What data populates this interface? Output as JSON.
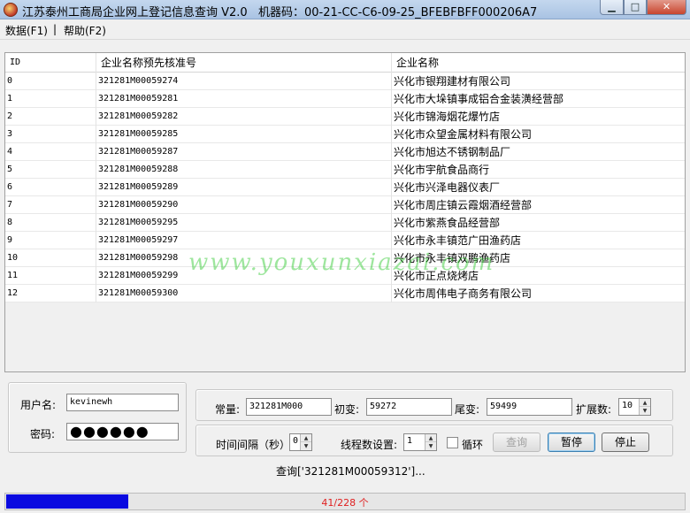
{
  "window": {
    "title": "江苏泰州工商局企业网上登记信息查询 V2.0",
    "machine_code": "机器码：00-21-CC-C6-09-25_BFEBFBFF000206A7",
    "min_glyph": "▁",
    "max_glyph": "□",
    "close_glyph": "✕"
  },
  "menu": {
    "data": "数据(F1)",
    "separator": "|",
    "help": "帮助(F2)"
  },
  "table": {
    "headers": {
      "id": "ID",
      "code": "企业名称预先核准号",
      "name": "企业名称"
    },
    "rows": [
      {
        "id": "0",
        "code": "321281M00059274",
        "name": "兴化市银翔建材有限公司"
      },
      {
        "id": "1",
        "code": "321281M00059281",
        "name": "兴化市大垛镇事成铝合金装潢经营部"
      },
      {
        "id": "2",
        "code": "321281M00059282",
        "name": "兴化市锦海烟花爆竹店"
      },
      {
        "id": "3",
        "code": "321281M00059285",
        "name": "兴化市众望金属材料有限公司"
      },
      {
        "id": "4",
        "code": "321281M00059287",
        "name": "兴化市旭达不锈钢制品厂"
      },
      {
        "id": "5",
        "code": "321281M00059288",
        "name": "兴化市宇航食品商行"
      },
      {
        "id": "6",
        "code": "321281M00059289",
        "name": "兴化市兴泽电器仪表厂"
      },
      {
        "id": "7",
        "code": "321281M00059290",
        "name": "兴化市周庄镇云霞烟酒经营部"
      },
      {
        "id": "8",
        "code": "321281M00059295",
        "name": "兴化市紫燕食品经营部"
      },
      {
        "id": "9",
        "code": "321281M00059297",
        "name": "兴化市永丰镇范广田渔药店"
      },
      {
        "id": "10",
        "code": "321281M00059298",
        "name": "兴化市永丰镇双鹏渔药店"
      },
      {
        "id": "11",
        "code": "321281M00059299",
        "name": "兴化市正点烧烤店"
      },
      {
        "id": "12",
        "code": "321281M00059300",
        "name": "兴化市周伟电子商务有限公司"
      }
    ]
  },
  "watermark": "www.youxunxiazai.com",
  "login": {
    "username_label": "用户名:",
    "username_value": "kevinewh",
    "password_label": "密码:",
    "password_value": "●●●●●●"
  },
  "params": {
    "constant_label": "常量:",
    "constant_value": "321281M000",
    "start_label": "初变:",
    "start_value": "59272",
    "end_label": "尾变:",
    "end_value": "59499",
    "expand_label": "扩展数:",
    "expand_value": "10",
    "interval_label": "时间间隔（秒）:",
    "interval_value": "0",
    "threads_label": "线程数设置:",
    "threads_value": "1",
    "loop_label": "循环",
    "loop_checked": false,
    "query_button": "查询",
    "pause_button": "暂停",
    "stop_button": "停止"
  },
  "status": {
    "query_text": "查询['321281M00059312']..."
  },
  "progress": {
    "text": "41/228 个",
    "current": 41,
    "total": 228
  }
}
